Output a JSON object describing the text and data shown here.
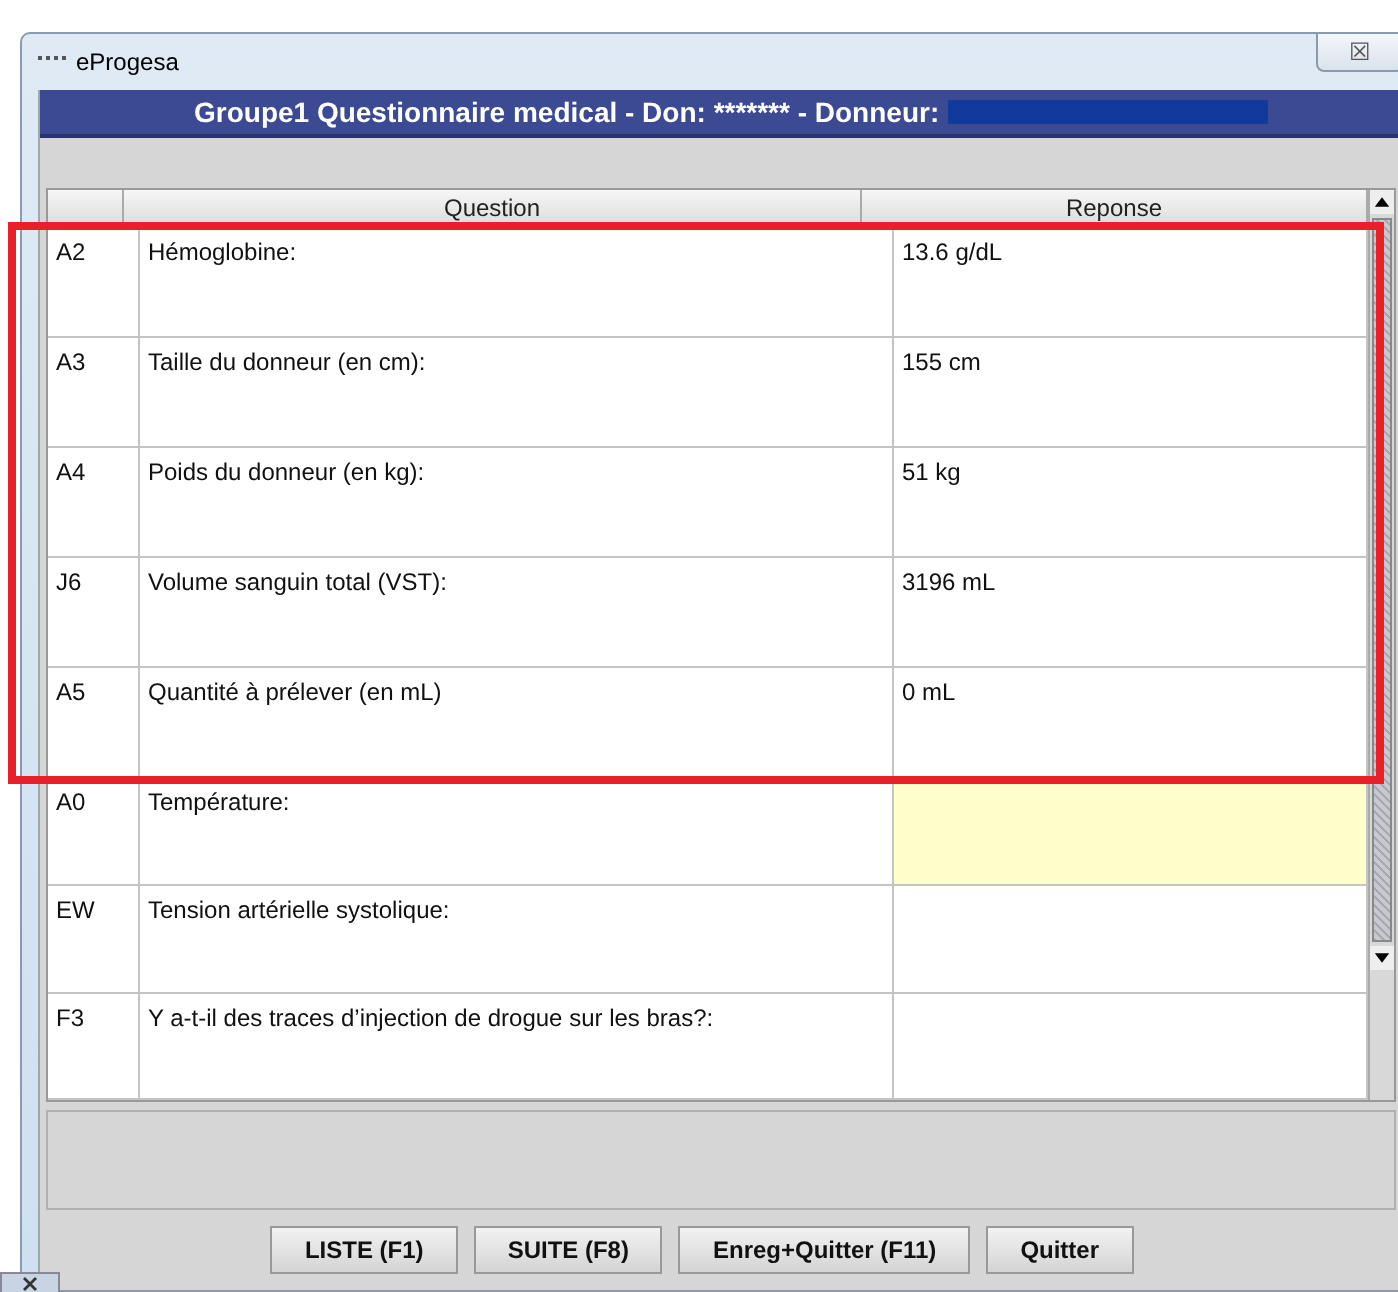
{
  "window": {
    "title": "eProgesa",
    "close": "☒"
  },
  "header": {
    "title": "Groupe1 Questionnaire medical - Don: ******* - Donneur:",
    "redacted": true
  },
  "table": {
    "columns": [
      "Question",
      "Reponse"
    ],
    "rows": [
      {
        "code": "A2",
        "question": "Hémoglobine:",
        "answer": "13.6 g/dL",
        "highlighted": false,
        "framed": true
      },
      {
        "code": "A3",
        "question": "Taille du donneur (en cm):",
        "answer": "155 cm",
        "highlighted": false,
        "framed": true
      },
      {
        "code": "A4",
        "question": "Poids du donneur (en kg):",
        "answer": "51 kg",
        "highlighted": false,
        "framed": true
      },
      {
        "code": "J6",
        "question": "Volume sanguin total (VST):",
        "answer": "3196 mL",
        "highlighted": false,
        "framed": true
      },
      {
        "code": "A5",
        "question": "Quantité à prélever (en mL)",
        "answer": "0 mL",
        "highlighted": false,
        "framed": true
      },
      {
        "code": "A0",
        "question": "Température:",
        "answer": "",
        "highlighted": true,
        "framed": false
      },
      {
        "code": "EW",
        "question": "Tension artérielle systolique:",
        "answer": "",
        "highlighted": false,
        "framed": false
      },
      {
        "code": "F3",
        "question": "Y a-t-il des traces d’injection de drogue sur les bras?:",
        "answer": "",
        "highlighted": false,
        "framed": false
      }
    ]
  },
  "buttons": [
    "LISTE (F1)",
    "SUITE (F8)",
    "Enreg+Quitter (F11)",
    "Quitter"
  ]
}
